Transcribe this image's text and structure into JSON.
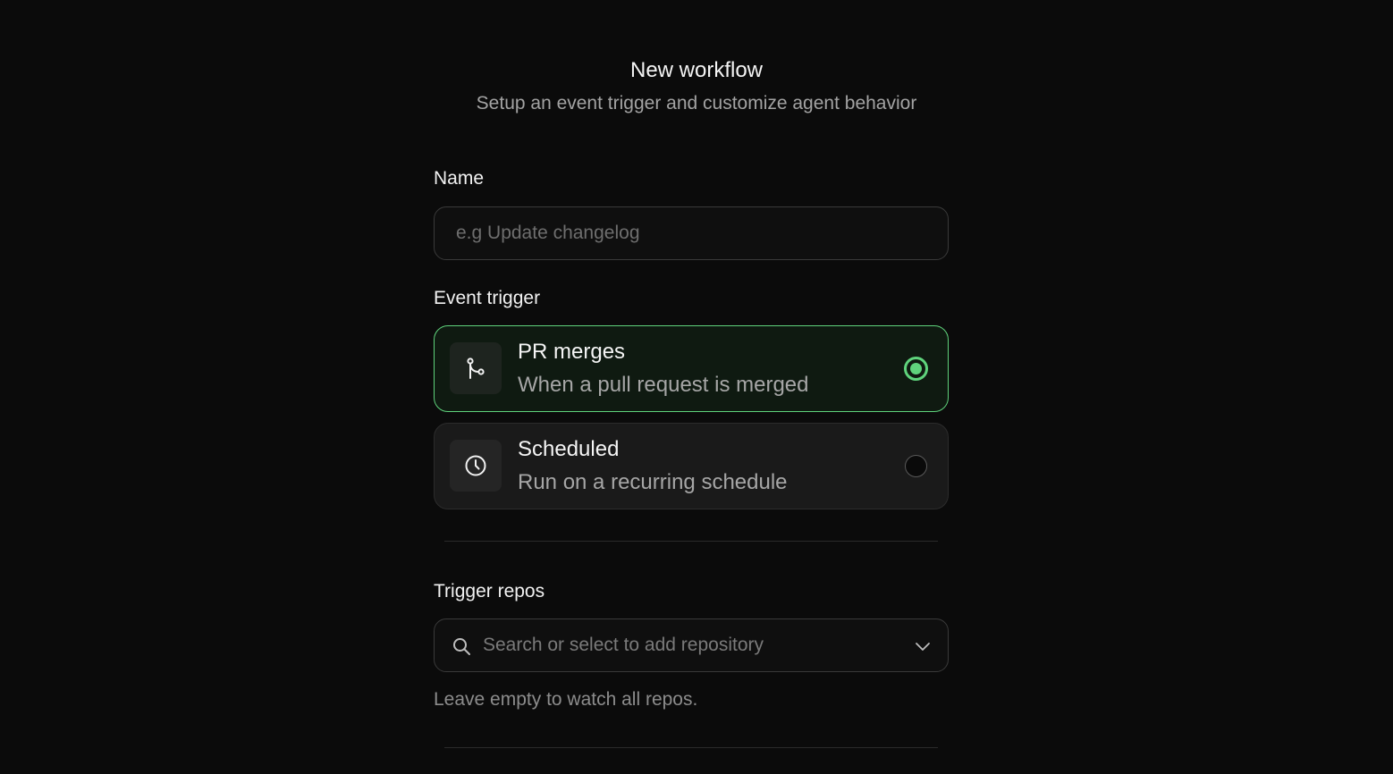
{
  "header": {
    "title": "New workflow",
    "subtitle": "Setup an event trigger and customize agent behavior"
  },
  "form": {
    "name": {
      "label": "Name",
      "value": "",
      "placeholder": "e.g Update changelog"
    },
    "event_trigger": {
      "label": "Event trigger",
      "selected": "pr_merges",
      "options": [
        {
          "id": "pr_merges",
          "icon": "git-merge-icon",
          "title": "PR merges",
          "description": "When a pull request is merged"
        },
        {
          "id": "scheduled",
          "icon": "clock-icon",
          "title": "Scheduled",
          "description": "Run on a recurring schedule"
        }
      ]
    },
    "trigger_repos": {
      "label": "Trigger repos",
      "placeholder": "Search or select to add repository",
      "hint": "Leave empty to watch all repos."
    }
  },
  "colors": {
    "background": "#0b0b0b",
    "accent": "#5fd37c",
    "selected_card_bg": "#0f1a11",
    "card_bg": "#1a1a1a",
    "muted_text": "#a3a3a3"
  }
}
